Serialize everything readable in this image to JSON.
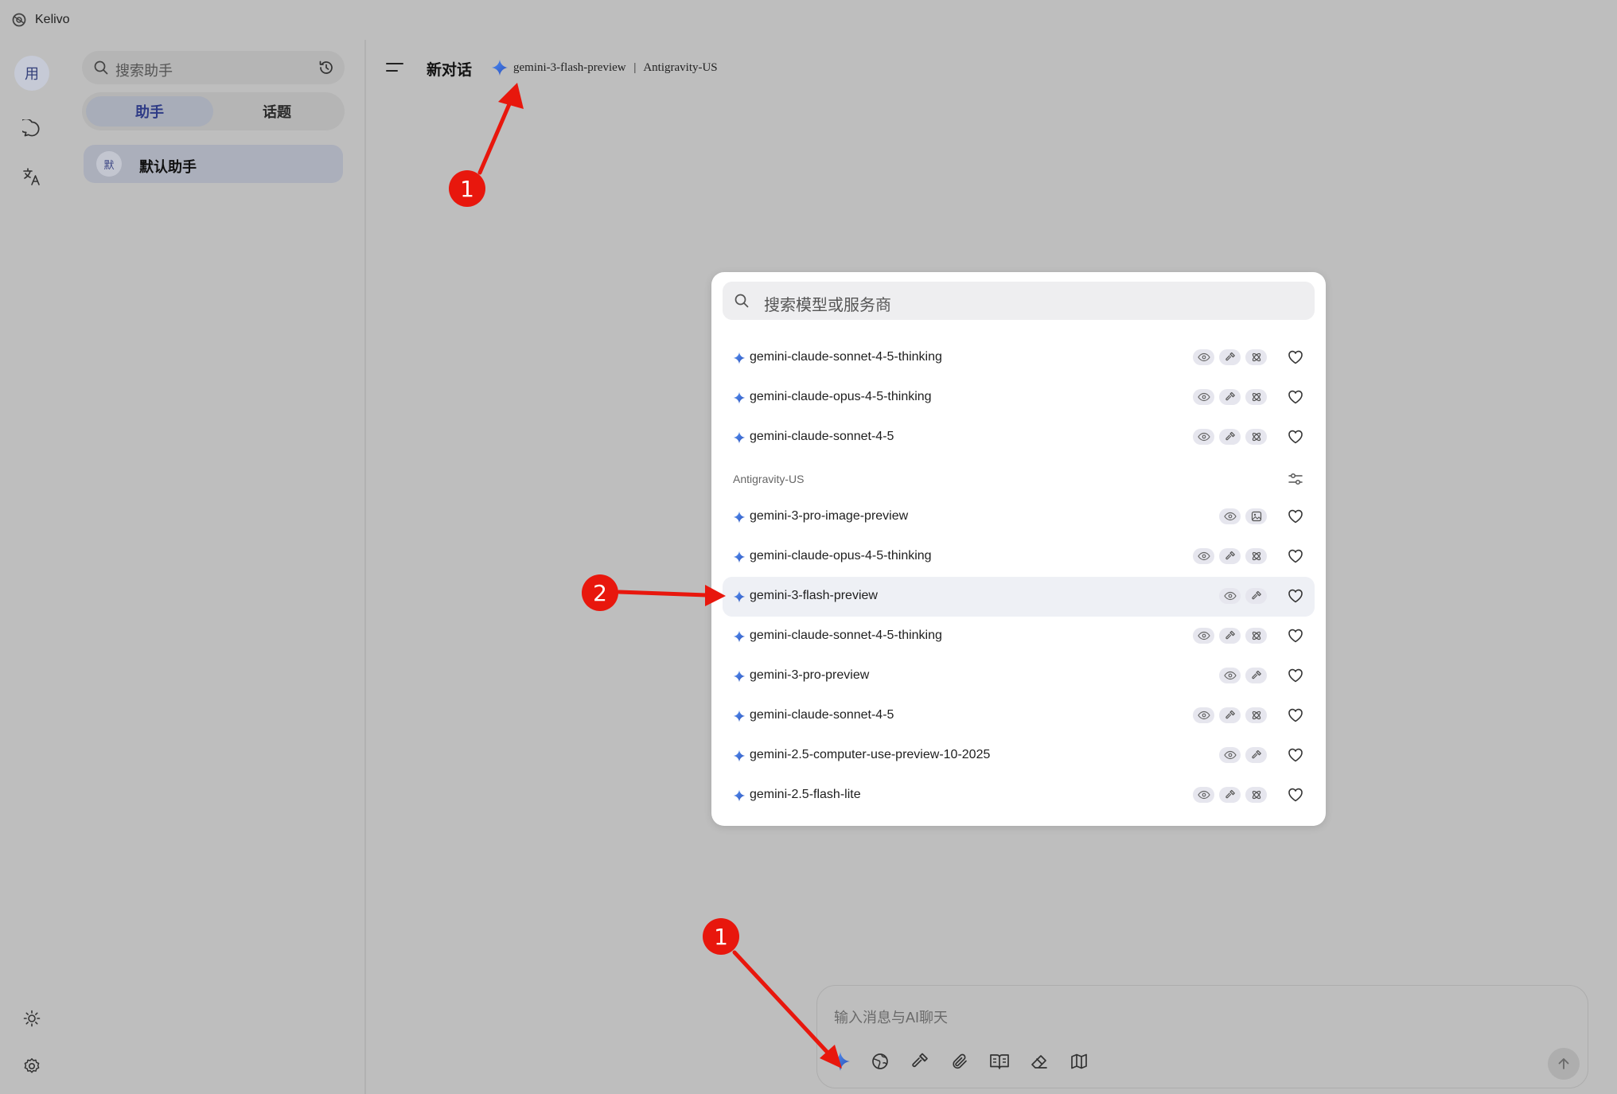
{
  "app": {
    "name": "Kelivo"
  },
  "rail": {
    "avatar": "用",
    "icons": [
      "chat-bubble-icon",
      "translate-icon",
      "sun-icon",
      "gear-icon"
    ]
  },
  "sidebar": {
    "search_placeholder": "搜索助手",
    "tabs": {
      "assistant": "助手",
      "topics": "话题"
    },
    "assistant_item": {
      "avatar": "默",
      "name": "默认助手"
    }
  },
  "header": {
    "chat_title": "新对话",
    "model_name": "gemini-3-flash-preview",
    "separator": "|",
    "provider": "Antigravity-US"
  },
  "model_picker": {
    "search_placeholder": "搜索模型或服务商",
    "top_items": [
      {
        "name": "gemini-claude-sonnet-4-5-thinking",
        "caps": [
          "eye-icon",
          "hammer-icon",
          "atom-icon"
        ]
      },
      {
        "name": "gemini-claude-opus-4-5-thinking",
        "caps": [
          "eye-icon",
          "hammer-icon",
          "atom-icon"
        ]
      },
      {
        "name": "gemini-claude-sonnet-4-5",
        "caps": [
          "eye-icon",
          "hammer-icon",
          "atom-icon"
        ]
      }
    ],
    "group": {
      "name": "Antigravity-US",
      "items": [
        {
          "name": "gemini-3-pro-image-preview",
          "caps": [
            "eye-icon",
            "image-icon"
          ]
        },
        {
          "name": "gemini-claude-opus-4-5-thinking",
          "caps": [
            "eye-icon",
            "hammer-icon",
            "atom-icon"
          ]
        },
        {
          "name": "gemini-3-flash-preview",
          "caps": [
            "eye-icon",
            "hammer-icon"
          ],
          "selected": true
        },
        {
          "name": "gemini-claude-sonnet-4-5-thinking",
          "caps": [
            "eye-icon",
            "hammer-icon",
            "atom-icon"
          ]
        },
        {
          "name": "gemini-3-pro-preview",
          "caps": [
            "eye-icon",
            "hammer-icon"
          ]
        },
        {
          "name": "gemini-claude-sonnet-4-5",
          "caps": [
            "eye-icon",
            "hammer-icon",
            "atom-icon"
          ]
        },
        {
          "name": "gemini-2.5-computer-use-preview-10-2025",
          "caps": [
            "eye-icon",
            "hammer-icon"
          ]
        },
        {
          "name": "gemini-2.5-flash-lite",
          "caps": [
            "eye-icon",
            "hammer-icon",
            "atom-icon"
          ]
        }
      ]
    }
  },
  "composer": {
    "placeholder": "输入消息与AI聊天",
    "tools": [
      "model-star-icon",
      "globe-icon",
      "hammer-icon",
      "paperclip-icon",
      "book-icon",
      "eraser-icon",
      "map-icon"
    ]
  },
  "annotations": {
    "badges": [
      "1",
      "2",
      "1"
    ]
  },
  "colors": {
    "background": "#bebebe",
    "annotation_red": "#e8170d",
    "accent_blue": "#2e3b86"
  }
}
